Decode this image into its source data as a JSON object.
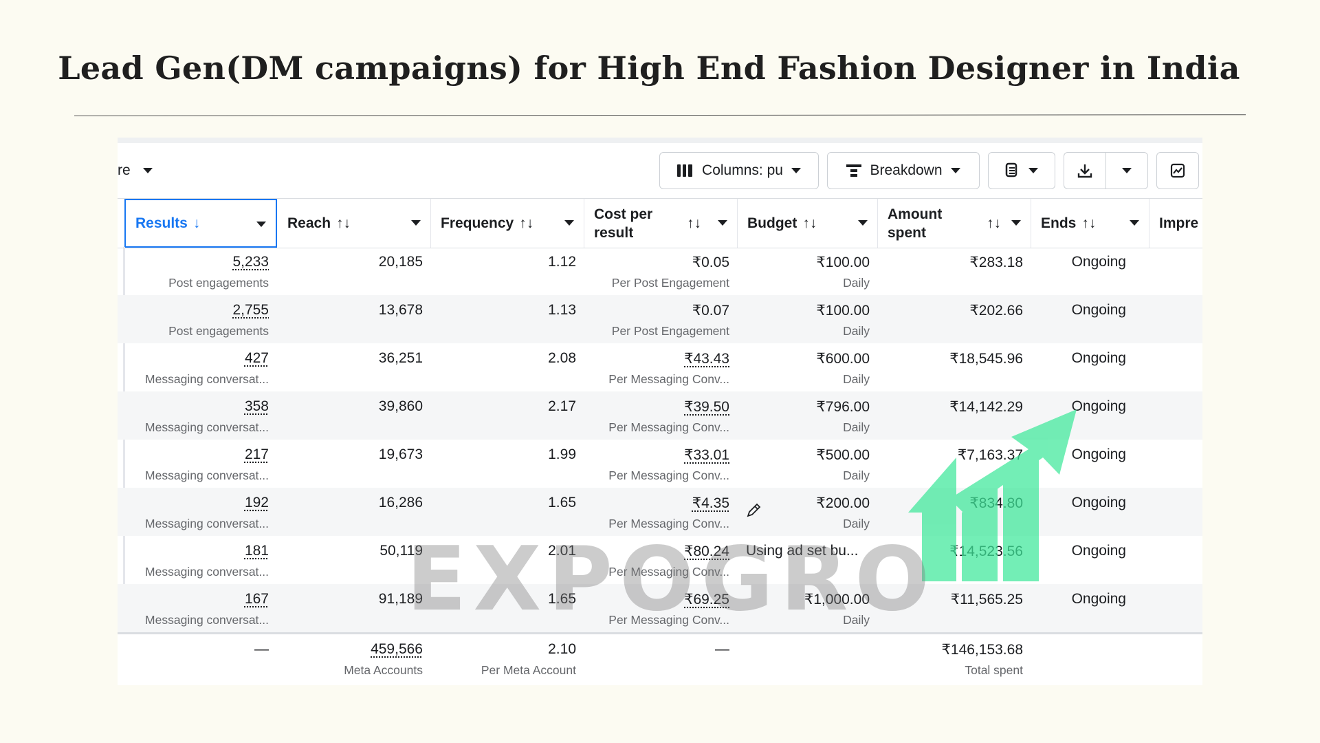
{
  "page_title": "Lead Gen(DM campaigns) for High End Fashion Designer in India",
  "toolbar": {
    "left_label": "re",
    "columns_label": "Columns: pu",
    "breakdown_label": "Breakdown"
  },
  "headers": {
    "results": "Results",
    "reach": "Reach",
    "frequency": "Frequency",
    "cost_per_result": "Cost per result",
    "budget": "Budget",
    "amount_spent": "Amount spent",
    "ends": "Ends",
    "impressions": "Impre"
  },
  "sort_icons": {
    "down": "↓",
    "both": "↑↓"
  },
  "rows": [
    {
      "results": "5,233",
      "results_sub": "Post engagements",
      "reach": "20,185",
      "frequency": "1.12",
      "cpr": "₹0.05",
      "cpr_sub": "Per Post Engagement",
      "budget": "₹100.00",
      "budget_sub": "Daily",
      "spent": "₹283.18",
      "ends": "Ongoing"
    },
    {
      "results": "2,755",
      "results_sub": "Post engagements",
      "reach": "13,678",
      "frequency": "1.13",
      "cpr": "₹0.07",
      "cpr_sub": "Per Post Engagement",
      "budget": "₹100.00",
      "budget_sub": "Daily",
      "spent": "₹202.66",
      "ends": "Ongoing"
    },
    {
      "results": "427",
      "results_sub": "Messaging conversat...",
      "reach": "36,251",
      "frequency": "2.08",
      "cpr": "₹43.43",
      "cpr_sub": "Per Messaging Conv...",
      "budget": "₹600.00",
      "budget_sub": "Daily",
      "spent": "₹18,545.96",
      "ends": "Ongoing"
    },
    {
      "results": "358",
      "results_sub": "Messaging conversat...",
      "reach": "39,860",
      "frequency": "2.17",
      "cpr": "₹39.50",
      "cpr_sub": "Per Messaging Conv...",
      "budget": "₹796.00",
      "budget_sub": "Daily",
      "spent": "₹14,142.29",
      "ends": "Ongoing"
    },
    {
      "results": "217",
      "results_sub": "Messaging conversat...",
      "reach": "19,673",
      "frequency": "1.99",
      "cpr": "₹33.01",
      "cpr_sub": "Per Messaging Conv...",
      "budget": "₹500.00",
      "budget_sub": "Daily",
      "spent": "₹7,163.37",
      "ends": "Ongoing"
    },
    {
      "results": "192",
      "results_sub": "Messaging conversat...",
      "reach": "16,286",
      "frequency": "1.65",
      "cpr": "₹4.35",
      "cpr_sub": "Per Messaging Conv...",
      "budget": "₹200.00",
      "budget_sub": "Daily",
      "spent": "₹834.80",
      "ends": "Ongoing"
    },
    {
      "results": "181",
      "results_sub": "Messaging conversat...",
      "reach": "50,119",
      "frequency": "2.01",
      "cpr": "₹80.24",
      "cpr_sub": "Per Messaging Conv...",
      "budget": "Using ad set bu...",
      "budget_sub": "",
      "spent": "₹14,523.56",
      "ends": "Ongoing"
    },
    {
      "results": "167",
      "results_sub": "Messaging conversat...",
      "reach": "91,189",
      "frequency": "1.65",
      "cpr": "₹69.25",
      "cpr_sub": "Per Messaging Conv...",
      "budget": "₹1,000.00",
      "budget_sub": "Daily",
      "spent": "₹11,565.25",
      "ends": "Ongoing"
    }
  ],
  "totals": {
    "results": "—",
    "reach": "459,566",
    "reach_sub": "Meta Accounts",
    "frequency": "2.10",
    "frequency_sub": "Per Meta Account",
    "cpr": "—",
    "spent": "₹146,153.68",
    "spent_sub": "Total spent"
  },
  "watermark": "EXPOGRO",
  "colors": {
    "accent": "#1877f2",
    "watermark_green": "#3ee89a"
  }
}
